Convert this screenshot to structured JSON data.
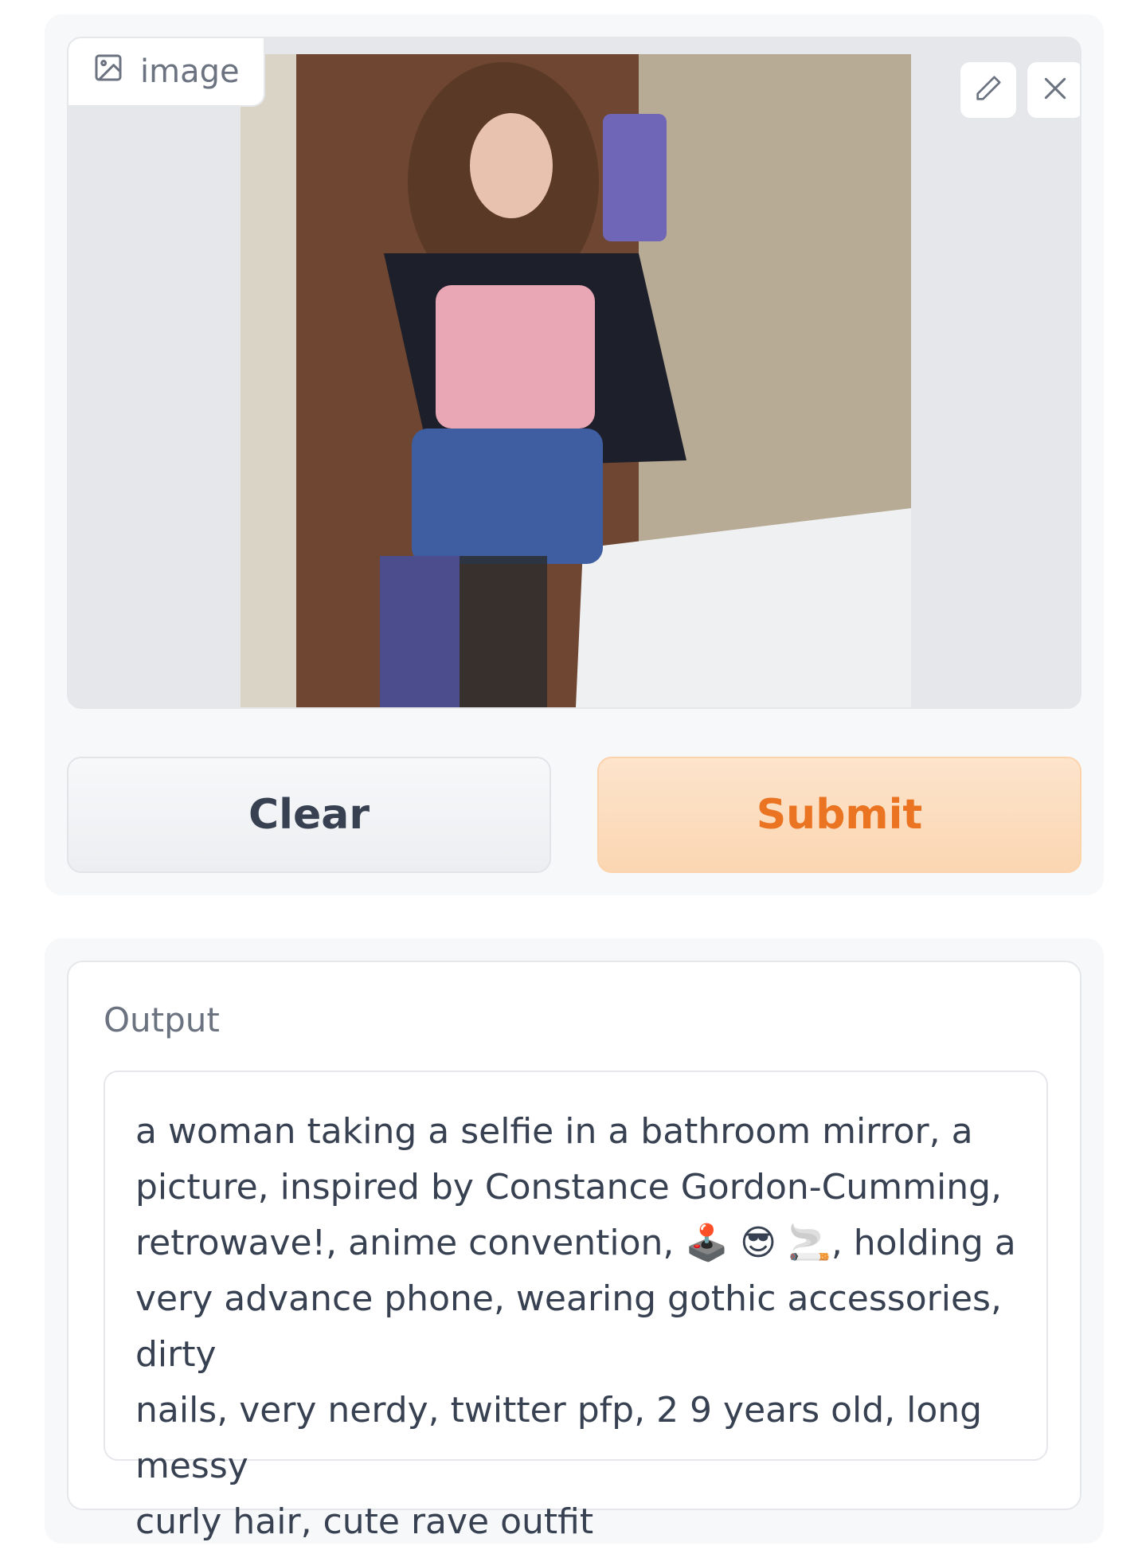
{
  "image_input": {
    "label": "image",
    "label_icon": "image-icon",
    "edit_icon": "pencil-icon",
    "close_icon": "close-icon"
  },
  "actions": {
    "clear_label": "Clear",
    "submit_label": "Submit"
  },
  "output": {
    "label": "Output",
    "text": "a woman taking a selfie in a bathroom mirror, a\npicture, inspired by Constance Gordon-Cumming,\nretrowave!, anime convention, 🕹️ 😎 🚬, holding a\nvery advance phone, wearing gothic accessories, dirty\nnails, very nerdy, twitter pfp, 2 9 years old, long messy\ncurly hair, cute rave outfit"
  },
  "colors": {
    "submit_text": "#ea7421",
    "submit_bg": "#fbd6b2",
    "panel_bg": "#f7f8fa"
  }
}
